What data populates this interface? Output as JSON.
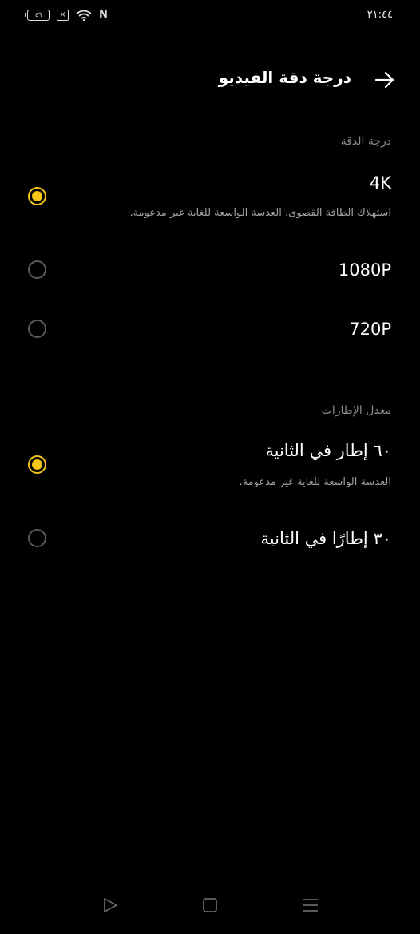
{
  "status_bar": {
    "time": "٢١:٤٤",
    "battery": "٤٦",
    "nfc": "N"
  },
  "header": {
    "title": "درجة دقة الفيديو"
  },
  "resolution_section": {
    "label": "درجة الدقة",
    "options": [
      {
        "title": "4K",
        "subtitle": "استهلاك الطاقة القصوى. العدسة الواسعة للغاية غير مدعومة.",
        "selected": true
      },
      {
        "title": "1080P",
        "selected": false
      },
      {
        "title": "720P",
        "selected": false
      }
    ]
  },
  "framerate_section": {
    "label": "معدل الإطارات",
    "options": [
      {
        "title": "٦٠ إطار في الثانية",
        "subtitle": "العدسة الواسعة للغاية غير مدعومة.",
        "selected": true
      },
      {
        "title": "٣٠ إطارًا في الثانية",
        "selected": false
      }
    ]
  },
  "colors": {
    "background": "#000000",
    "accent": "#f5c518",
    "divider": "#3a3a3a"
  },
  "icons": {
    "back": "arrow-right-icon",
    "nav_back": "triangle-back-icon",
    "nav_home": "square-home-icon",
    "nav_recents": "menu-lines-icon"
  }
}
